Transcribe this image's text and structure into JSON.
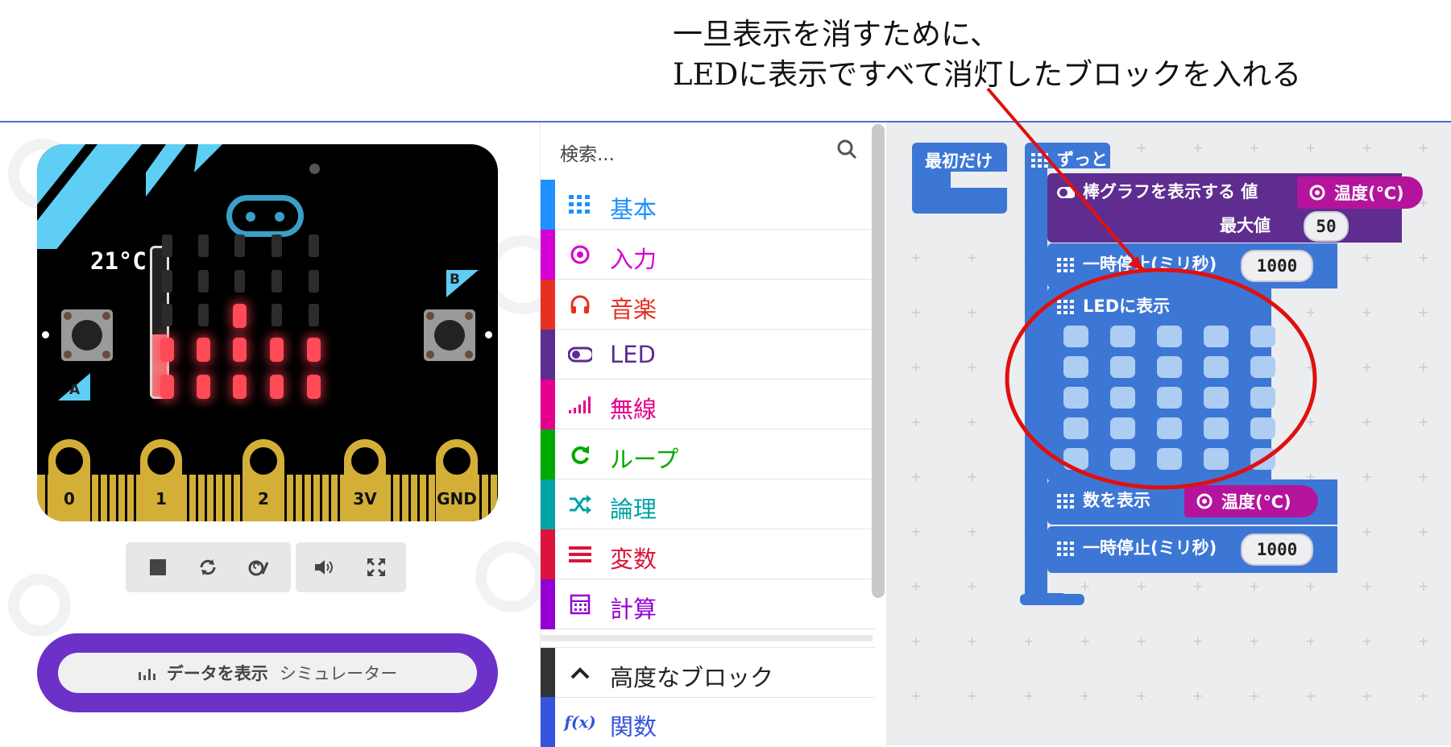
{
  "annotation": {
    "line1": "一旦表示を消すために、",
    "line2": "LEDに表示ですべて消灯したブロックを入れる"
  },
  "simulator": {
    "temperature_label": "21°C",
    "temperature_level": 0.42,
    "button_a_label": "A",
    "button_b_label": "B",
    "pins": [
      "0",
      "1",
      "2",
      "3V",
      "GND"
    ],
    "led_rows": [
      [
        0,
        0,
        0,
        0,
        0
      ],
      [
        0,
        0,
        0,
        0,
        0
      ],
      [
        0,
        0,
        1,
        0,
        0
      ],
      [
        1,
        1,
        1,
        1,
        1
      ],
      [
        1,
        1,
        1,
        1,
        1
      ]
    ],
    "controls": [
      "stop-icon",
      "restart-icon",
      "slow-motion-icon",
      "mute-icon",
      "fullscreen-icon"
    ],
    "data_button_icon": "bar-chart-icon",
    "data_button_label": "データを表示",
    "data_button_sub": "シミュレーター"
  },
  "toolbox": {
    "search_placeholder": "検索...",
    "categories": [
      {
        "label": "基本",
        "icon": "grid-icon",
        "color": "#1e90ff"
      },
      {
        "label": "入力",
        "icon": "target-icon",
        "color": "#d400d4"
      },
      {
        "label": "音楽",
        "icon": "headphones-icon",
        "color": "#e63022"
      },
      {
        "label": "LED",
        "icon": "toggle-icon",
        "color": "#5c2d91"
      },
      {
        "label": "無線",
        "icon": "signal-icon",
        "color": "#e3008c"
      },
      {
        "label": "ループ",
        "icon": "loop-icon",
        "color": "#00aa00"
      },
      {
        "label": "論理",
        "icon": "shuffle-icon",
        "color": "#00a4a6"
      },
      {
        "label": "変数",
        "icon": "list-icon",
        "color": "#dc143c"
      },
      {
        "label": "計算",
        "icon": "calculator-icon",
        "color": "#9400d3"
      }
    ],
    "advanced_label": "高度なブロック",
    "functions_label": "関数",
    "functions_icon": "f(x)"
  },
  "workspace": {
    "on_start_label": "最初だけ",
    "forever_label": "ずっと",
    "bargraph_label": "棒グラフを表示する 値",
    "temperature_label": "温度(℃)",
    "max_label": "最大値",
    "max_value": "50",
    "pause_label": "一時停止(ミリ秒)",
    "pause_value": "1000",
    "show_leds_label": "LEDに表示",
    "show_number_label": "数を表示",
    "pause2_label": "一時停止(ミリ秒)",
    "pause2_value": "1000"
  },
  "colors": {
    "accent_blue": "#3d77d6",
    "led_purple": "#5e2d8f",
    "input_magenta": "#b4149c",
    "annotation_red": "#e01010"
  }
}
